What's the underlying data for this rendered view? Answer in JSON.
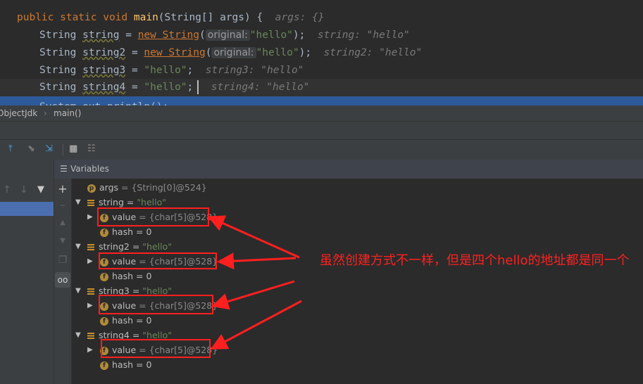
{
  "code": {
    "line1": {
      "pre": "public static void ",
      "fn": "main",
      "mid": "(String[] args) {",
      "hint": "args: {}"
    },
    "line2": {
      "pre": "String ",
      "var": "string",
      "eq": " = ",
      "new": "new String",
      "paren": "(",
      "pill": "original:",
      "lit": "\"hello\"",
      "post": ");",
      "hint": "string: \"hello\""
    },
    "line3": {
      "pre": "String ",
      "var": "string2",
      "eq": " = ",
      "new": "new String",
      "paren": "(",
      "pill": "original:",
      "lit": "\"hello\"",
      "post": ");",
      "hint": "string2: \"hello\""
    },
    "line4": {
      "pre": "String ",
      "var": "string3",
      "eq": " = ",
      "lit": "\"hello\"",
      "post": ";",
      "hint": "string3: \"hello\""
    },
    "line5": {
      "pre": "String ",
      "var": "string4",
      "eq": " = ",
      "lit": "\"hello\"",
      "post": ";",
      "hint": "string4: \"hello\""
    },
    "line6": {
      "text": "System.out.println();"
    }
  },
  "breadcrumb": {
    "class": "ObjectJdk",
    "method": "main()"
  },
  "variables": {
    "title": "Variables",
    "args": {
      "badge": "p",
      "name": "args",
      "value": "= {String[0]@524}"
    },
    "groups": [
      {
        "name": "string",
        "eq": " = ",
        "value": "\"hello\"",
        "field_value": "= {char[5]@528}",
        "field_hash": "= 0"
      },
      {
        "name": "string2",
        "eq": " = ",
        "value": "\"hello\"",
        "field_value": "= {char[5]@528}",
        "field_hash": "= 0"
      },
      {
        "name": "string3",
        "eq": " = ",
        "value": "\"hello\"",
        "field_value": "= {char[5]@528}",
        "field_hash": "= 0"
      },
      {
        "name": "string4",
        "eq": " = ",
        "value": "\"hello\"",
        "field_value": "= {char[5]@528}",
        "field_hash": "= 0"
      }
    ],
    "field_badge": "f",
    "value_label": "value",
    "hash_label": "hash"
  },
  "annotation": "虽然创建方式不一样，但是四个hello的地址都是同一个",
  "colors": {
    "annotation": "#ff2020",
    "box": "#ff1f1f",
    "exec_line": "#2d5a9a"
  },
  "icons": [
    "step-out-icon",
    "drop-frame-icon",
    "run-to-cursor-icon",
    "evaluate-icon",
    "trace-icon",
    "arrow-up-icon",
    "arrow-down-icon",
    "filter-icon",
    "add-icon",
    "minus-icon",
    "move-up-icon",
    "move-down-icon",
    "copy-icon",
    "glasses-icon"
  ]
}
